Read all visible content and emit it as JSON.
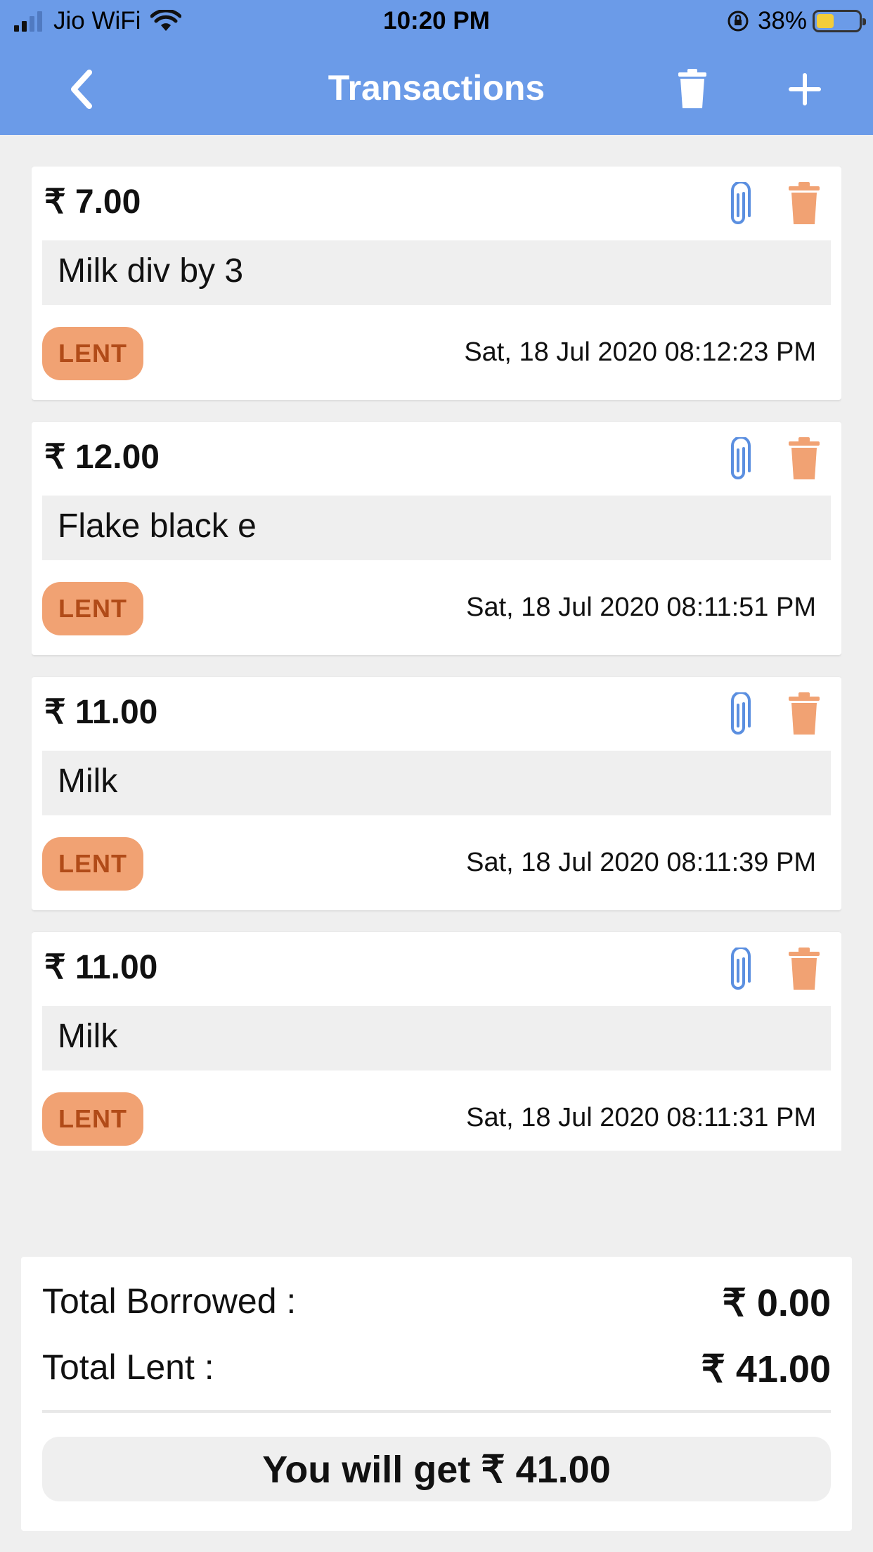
{
  "status_bar": {
    "carrier": "Jio WiFi",
    "time": "10:20 PM",
    "battery": "38%",
    "battery_color": "#f3cd3a"
  },
  "nav": {
    "title": "Transactions",
    "back_icon": "chevron-left-icon",
    "trash_icon": "trash-icon",
    "add_icon": "plus-icon",
    "background": "#6b9be8"
  },
  "transactions": [
    {
      "amount": "₹ 7.00",
      "note": "Milk div by 3",
      "type": "LENT",
      "date": "Sat, 18 Jul 2020 08:12:23 PM"
    },
    {
      "amount": "₹ 12.00",
      "note": "Flake black e",
      "type": "LENT",
      "date": "Sat, 18 Jul 2020 08:11:51 PM"
    },
    {
      "amount": "₹ 11.00",
      "note": "Milk",
      "type": "LENT",
      "date": "Sat, 18 Jul 2020 08:11:39 PM"
    },
    {
      "amount": "₹ 11.00",
      "note": "Milk",
      "type": "LENT",
      "date": "Sat, 18 Jul 2020 08:11:31 PM"
    }
  ],
  "icons": {
    "attach": "paperclip-icon",
    "delete": "trash-icon",
    "attach_color": "#5b8fe0",
    "delete_color": "#f1a273"
  },
  "summary": {
    "borrowed_label": "Total Borrowed :",
    "borrowed_value": "₹ 0.00",
    "lent_label": "Total Lent :",
    "lent_value": "₹ 41.00",
    "result": "You will get ₹ 41.00"
  }
}
